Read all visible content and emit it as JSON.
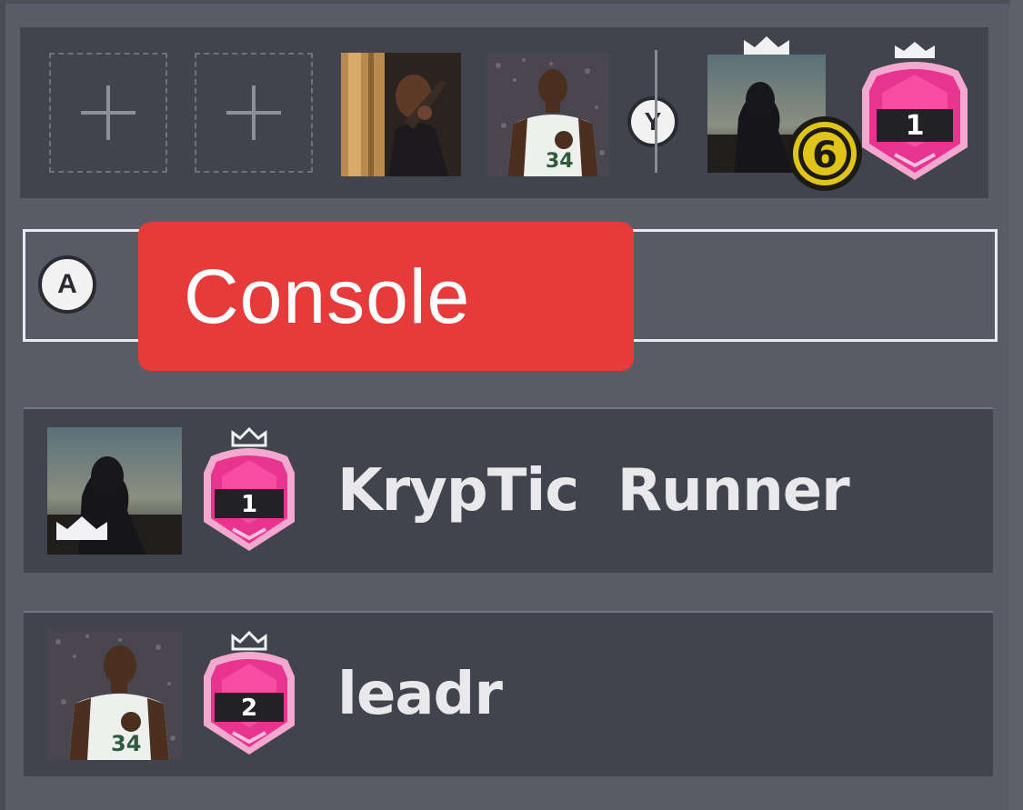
{
  "squad": {
    "empty_slots": 2,
    "y_button_label": "Y",
    "leader_rank": "1",
    "leader_badge_icon": "six-siege-icon",
    "leader_badge_label": "6"
  },
  "search": {
    "a_button_label": "A",
    "console_label": "Console"
  },
  "players": [
    {
      "name": "KrypTic  Runner",
      "rank": "1",
      "has_crown": true
    },
    {
      "name": "leadr",
      "rank": "2",
      "has_crown": false
    }
  ],
  "colors": {
    "panel": "#41434d",
    "background": "#5a5d67",
    "console_tag": "#e63b3b",
    "rank_pink": "#e8338f",
    "badge_gold": "#e0c419"
  }
}
